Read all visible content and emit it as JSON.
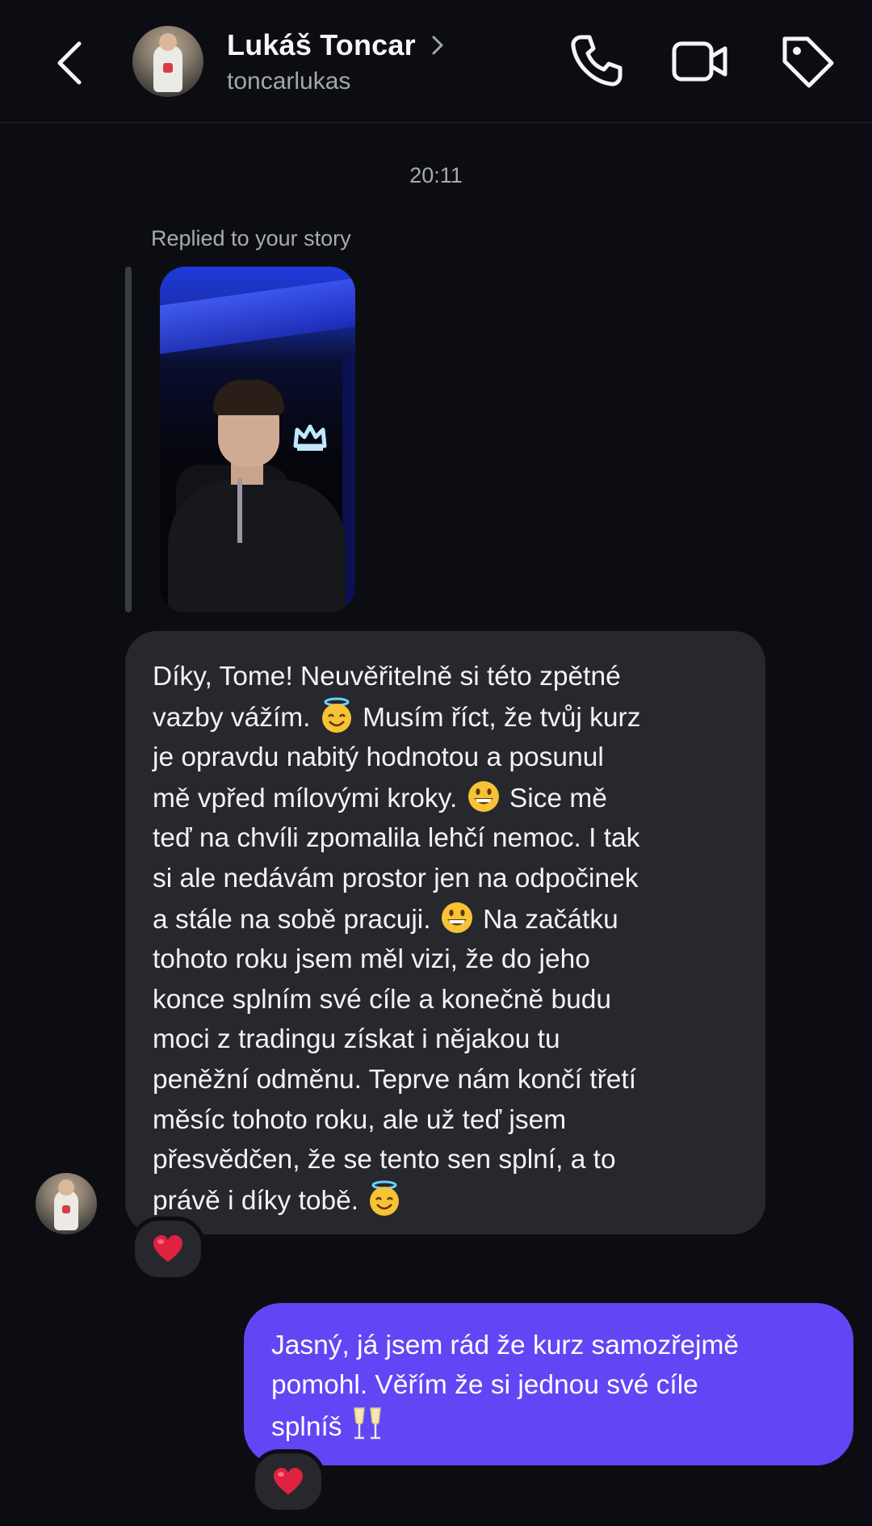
{
  "header": {
    "name": "Lukáš Toncar",
    "username": "toncarlukas"
  },
  "chat": {
    "timestamp": "20:11",
    "reply_label": "Replied to your story",
    "incoming": {
      "seg1": "Díky, Tome! Neuvěřitelně si této zpětné\nvazby vážím. ",
      "seg2": " Musím říct, že tvůj kurz\nje opravdu nabitý hodnotou a posunul\nmě vpřed mílovými kroky. ",
      "seg3": " Sice mě\nteď na chvíli zpomalila lehčí nemoc. I tak\nsi ale nedávám prostor jen na odpočinek\na stále na sobě pracuji. ",
      "seg4": " Na začátku\ntohoto roku jsem měl vizi, že do jeho\nkonce splním své cíle a konečně budu\nmoci z tradingu získat i nějakou tu\npeněžní odměnu. Teprve nám končí třetí\nměsíc tohoto roku, ale už teď jsem\npřesvědčen, že se tento sen splní, a to\nprávě i díky tobě. ",
      "reaction": "heart"
    },
    "outgoing": {
      "text": "Jasný, já jsem rád že kurz samozřejmě\npomohl. Věřím že si jednou své cíle\nsplníš ",
      "reaction": "heart"
    }
  },
  "colors": {
    "background": "#0c0d12",
    "incoming_bubble": "#26282e",
    "outgoing_bubble": "#6146f6",
    "heart": "#e0213f"
  }
}
